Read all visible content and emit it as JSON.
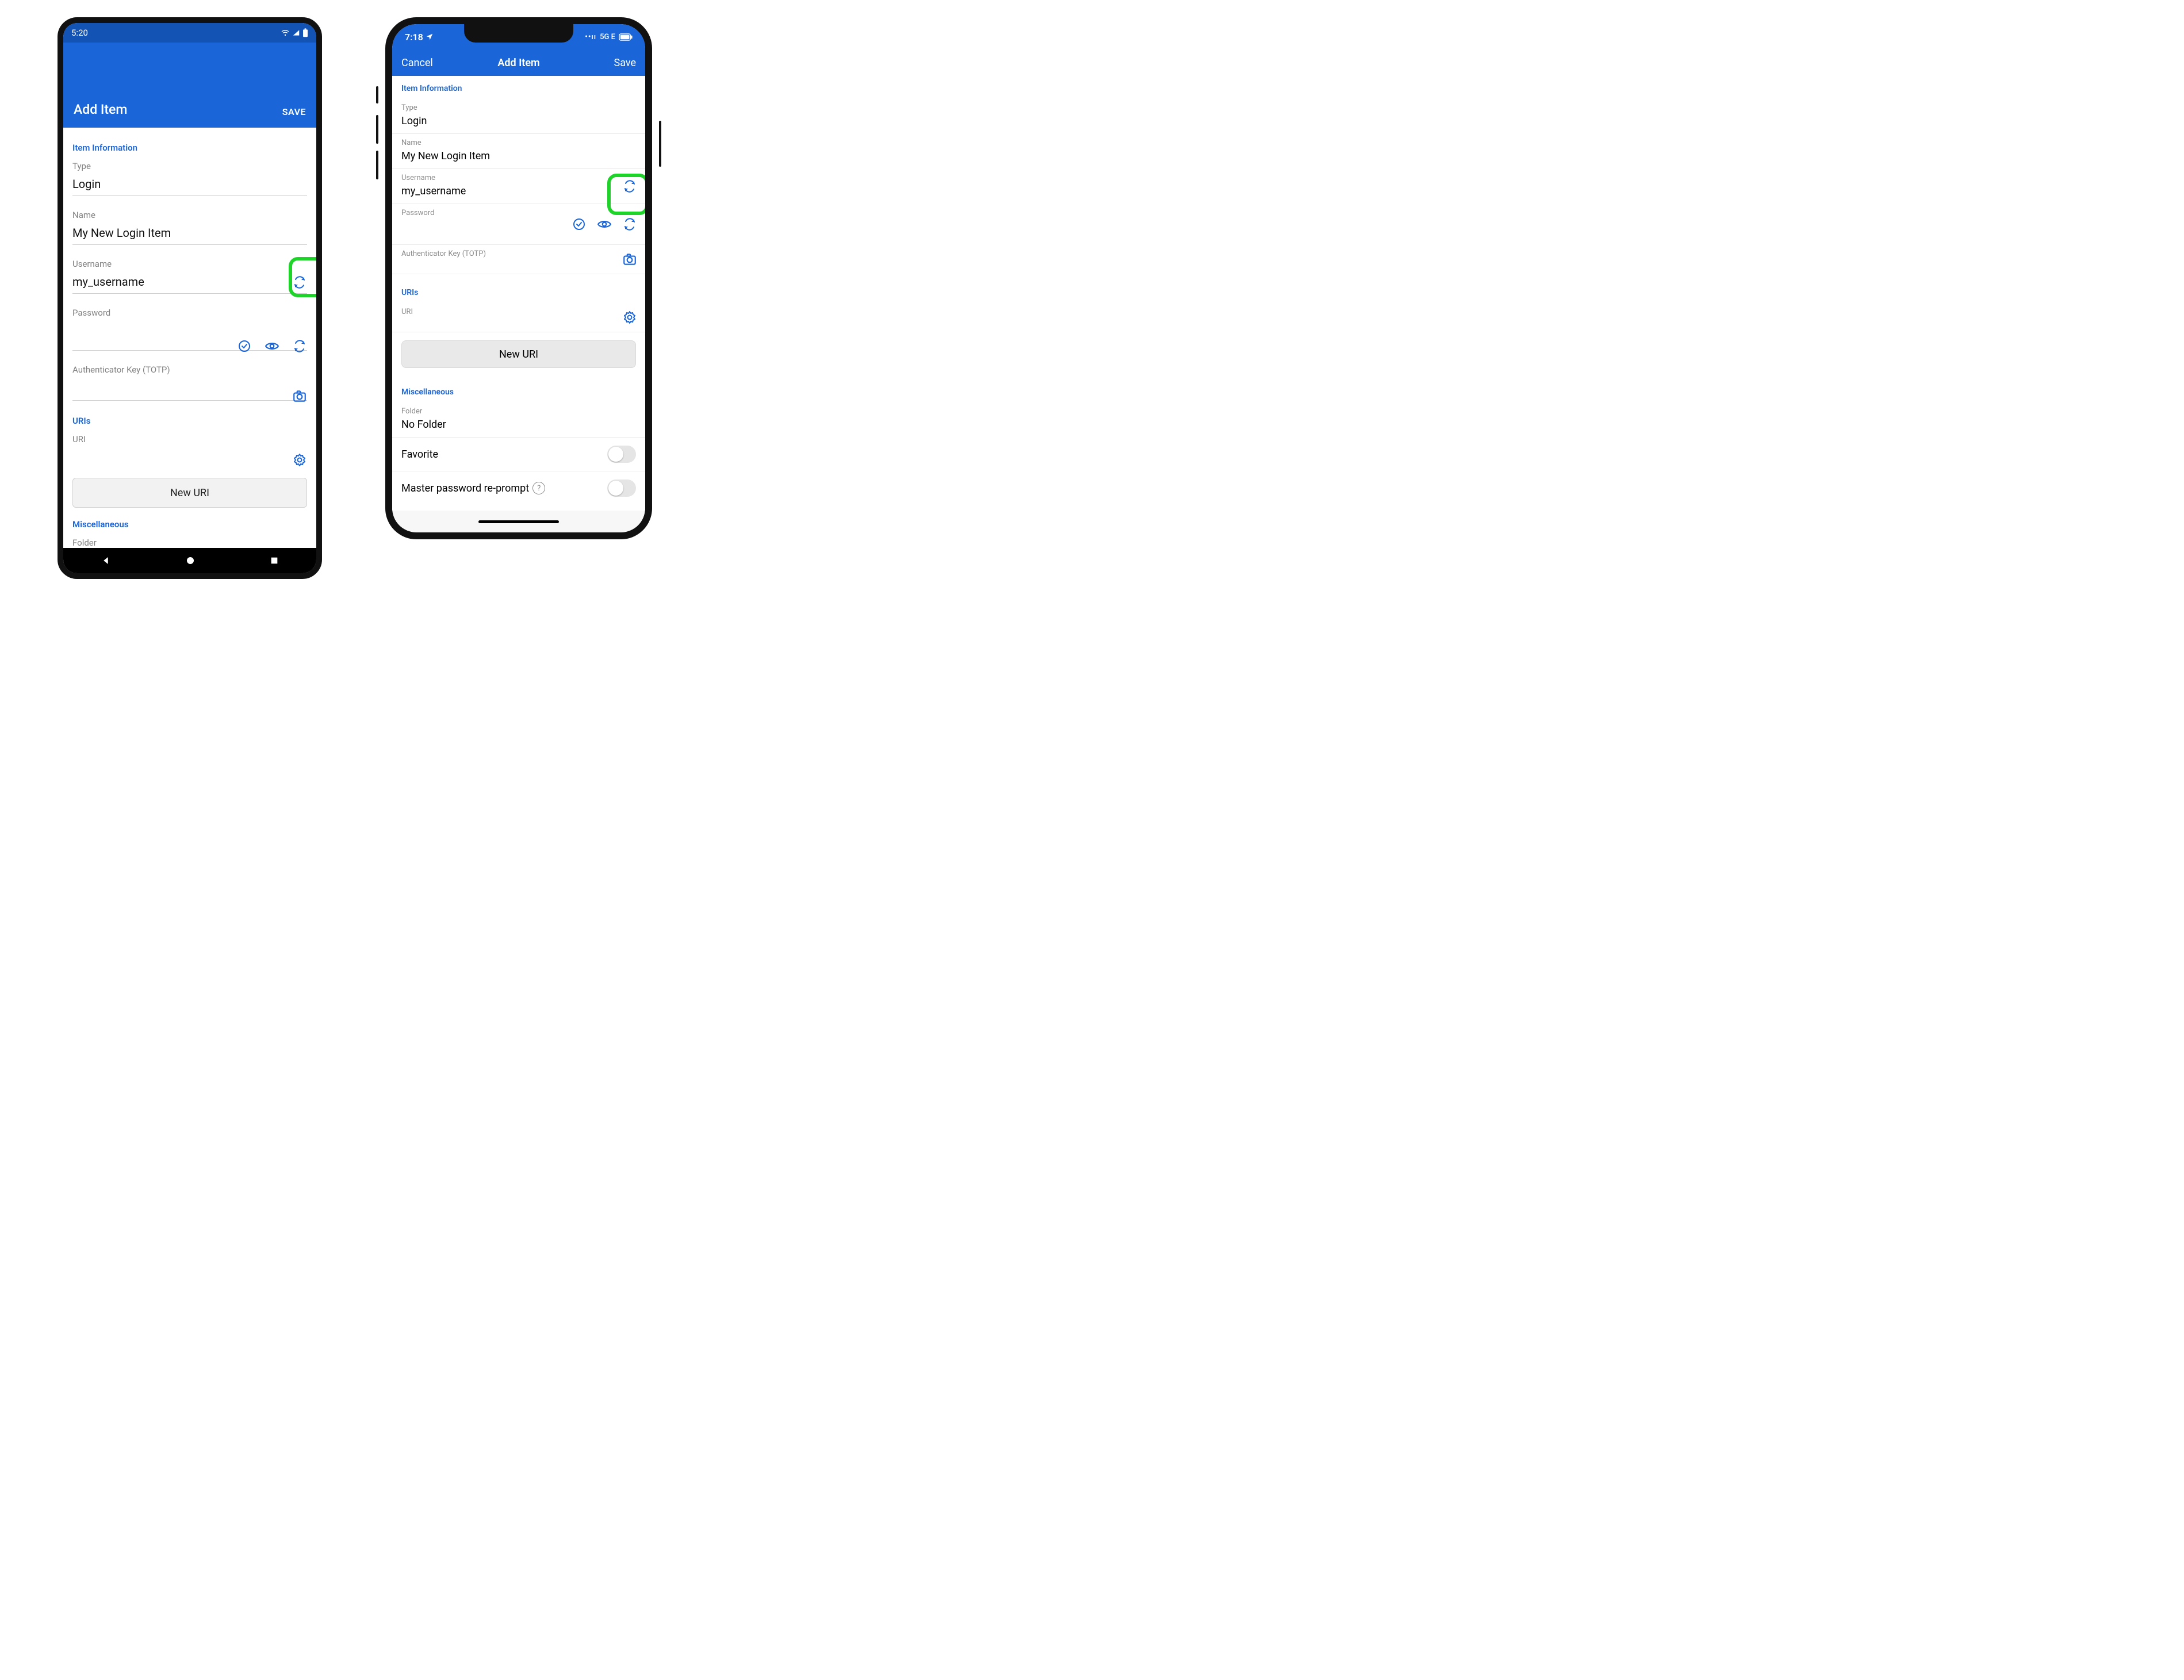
{
  "android": {
    "status_time": "5:20",
    "appbar_title": "Add Item",
    "appbar_save": "SAVE",
    "section_info": "Item Information",
    "type_label": "Type",
    "type_value": "Login",
    "name_label": "Name",
    "name_value": "My New Login Item",
    "username_label": "Username",
    "username_value": "my_username",
    "password_label": "Password",
    "password_value": "",
    "totp_label": "Authenticator Key (TOTP)",
    "section_uris": "URIs",
    "uri_label": "URI",
    "new_uri_button": "New URI",
    "section_misc": "Miscellaneous",
    "folder_label": "Folder"
  },
  "ios": {
    "status_time": "7:18",
    "status_net": "5G E",
    "cancel": "Cancel",
    "title": "Add Item",
    "save": "Save",
    "section_info": "Item Information",
    "type_label": "Type",
    "type_value": "Login",
    "name_label": "Name",
    "name_value": "My New Login Item",
    "username_label": "Username",
    "username_value": "my_username",
    "password_label": "Password",
    "password_value": "",
    "totp_label": "Authenticator Key (TOTP)",
    "section_uris": "URIs",
    "uri_label": "URI",
    "new_uri_button": "New URI",
    "section_misc": "Miscellaneous",
    "folder_label": "Folder",
    "folder_value": "No Folder",
    "favorite_label": "Favorite",
    "reprompt_label": "Master password re-prompt"
  }
}
